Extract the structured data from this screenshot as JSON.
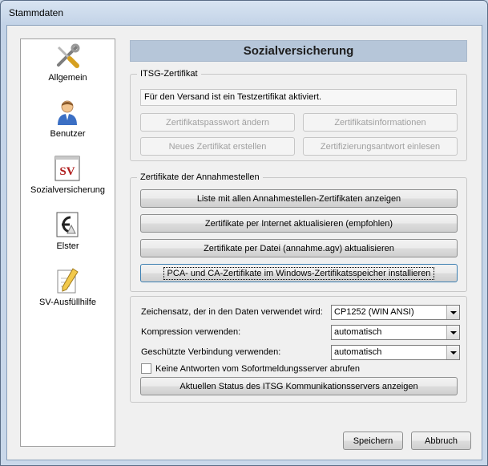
{
  "window": {
    "title": "Stammdaten"
  },
  "sidebar": {
    "items": [
      {
        "label": "Allgemein",
        "icon": "tools-icon"
      },
      {
        "label": "Benutzer",
        "icon": "user-icon"
      },
      {
        "label": "Sozialversicherung",
        "icon": "sv-icon",
        "icon_text": "SV"
      },
      {
        "label": "Elster",
        "icon": "elster-icon"
      },
      {
        "label": "SV-Ausfüllhilfe",
        "icon": "pencil-document-icon"
      }
    ],
    "active_index": 2
  },
  "header": {
    "title": "Sozialversicherung"
  },
  "itsg": {
    "title": "ITSG-Zertifikat",
    "info": "Für den Versand ist ein Testzertifikat aktiviert.",
    "buttons": {
      "change_password": "Zertifikatspasswort ändern",
      "info": "Zertifikatsinformationen",
      "new_cert": "Neues Zertifikat erstellen",
      "read_response": "Zertifizierungsantwort einlesen"
    }
  },
  "annahme": {
    "title": "Zertifikate der Annahmestellen",
    "buttons": {
      "list": "Liste mit allen Annahmestellen-Zertifikaten anzeigen",
      "internet": "Zertifikate per Internet aktualisieren  (empfohlen)",
      "file": "Zertifikate per Datei (annahme.agv) aktualisieren",
      "install": "PCA- und CA-Zertifikate im Windows-Zertifikatsspeicher installieren"
    }
  },
  "settings": {
    "charset_label": "Zeichensatz, der in den Daten verwendet wird:",
    "charset_value": "CP1252 (WIN ANSI)",
    "compression_label": "Kompression verwenden:",
    "compression_value": "automatisch",
    "secure_label": "Geschützte Verbindung verwenden:",
    "secure_value": "automatisch",
    "no_answers_label": "Keine Antworten vom Sofortmeldungsserver abrufen",
    "no_answers_checked": false,
    "status_button": "Aktuellen Status des ITSG Kommunikationsservers anzeigen"
  },
  "footer": {
    "save": "Speichern",
    "cancel": "Abbruch"
  }
}
